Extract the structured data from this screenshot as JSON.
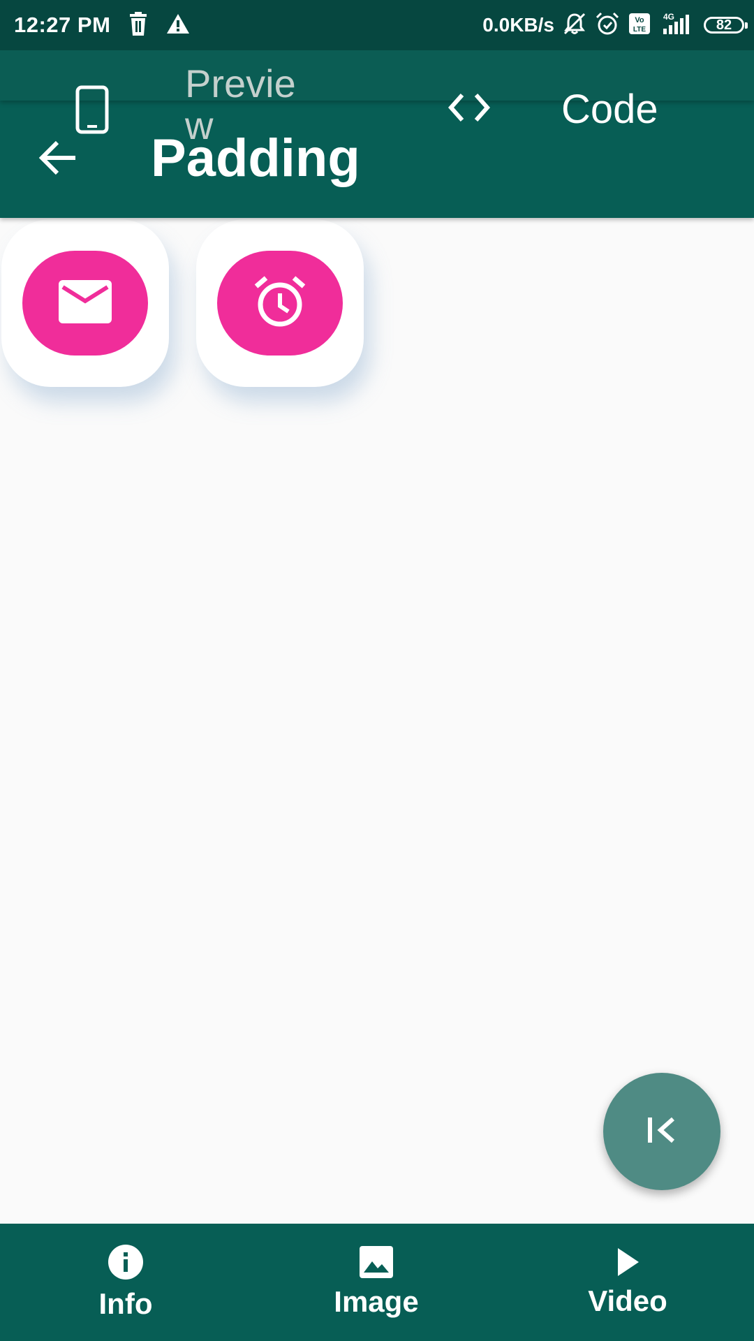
{
  "status_bar": {
    "time": "12:27 PM",
    "network_speed": "0.0KB/s",
    "battery_level": "82",
    "network_type": "4G",
    "volte_label": "Vo LTE",
    "left_icons": [
      "trash-icon",
      "warning-icon"
    ],
    "right_icons": [
      "mute-bell-icon",
      "alarm-icon",
      "volte-icon",
      "signal-icon",
      "battery-icon"
    ]
  },
  "tabs": {
    "preview_label": "Preview",
    "code_label": "Code",
    "preview_icon": "phone-icon",
    "code_icon": "code-icon"
  },
  "app_bar": {
    "title": "Padding",
    "back_icon": "arrow-back-icon"
  },
  "content": {
    "cards": [
      {
        "icon": "mail-icon",
        "color": "#f02d9a"
      },
      {
        "icon": "alarm-icon",
        "color": "#f02d9a"
      }
    ]
  },
  "fab": {
    "icon": "collapse-left-icon",
    "color": "#4f8b84"
  },
  "bottom_nav": {
    "items": [
      {
        "label": "Info",
        "icon": "info-icon"
      },
      {
        "label": "Image",
        "icon": "image-icon"
      },
      {
        "label": "Video",
        "icon": "play-icon"
      }
    ]
  },
  "colors": {
    "primary": "#075e55",
    "primary_dark": "#064740",
    "accent": "#f02d9a",
    "background": "#fafafa"
  }
}
